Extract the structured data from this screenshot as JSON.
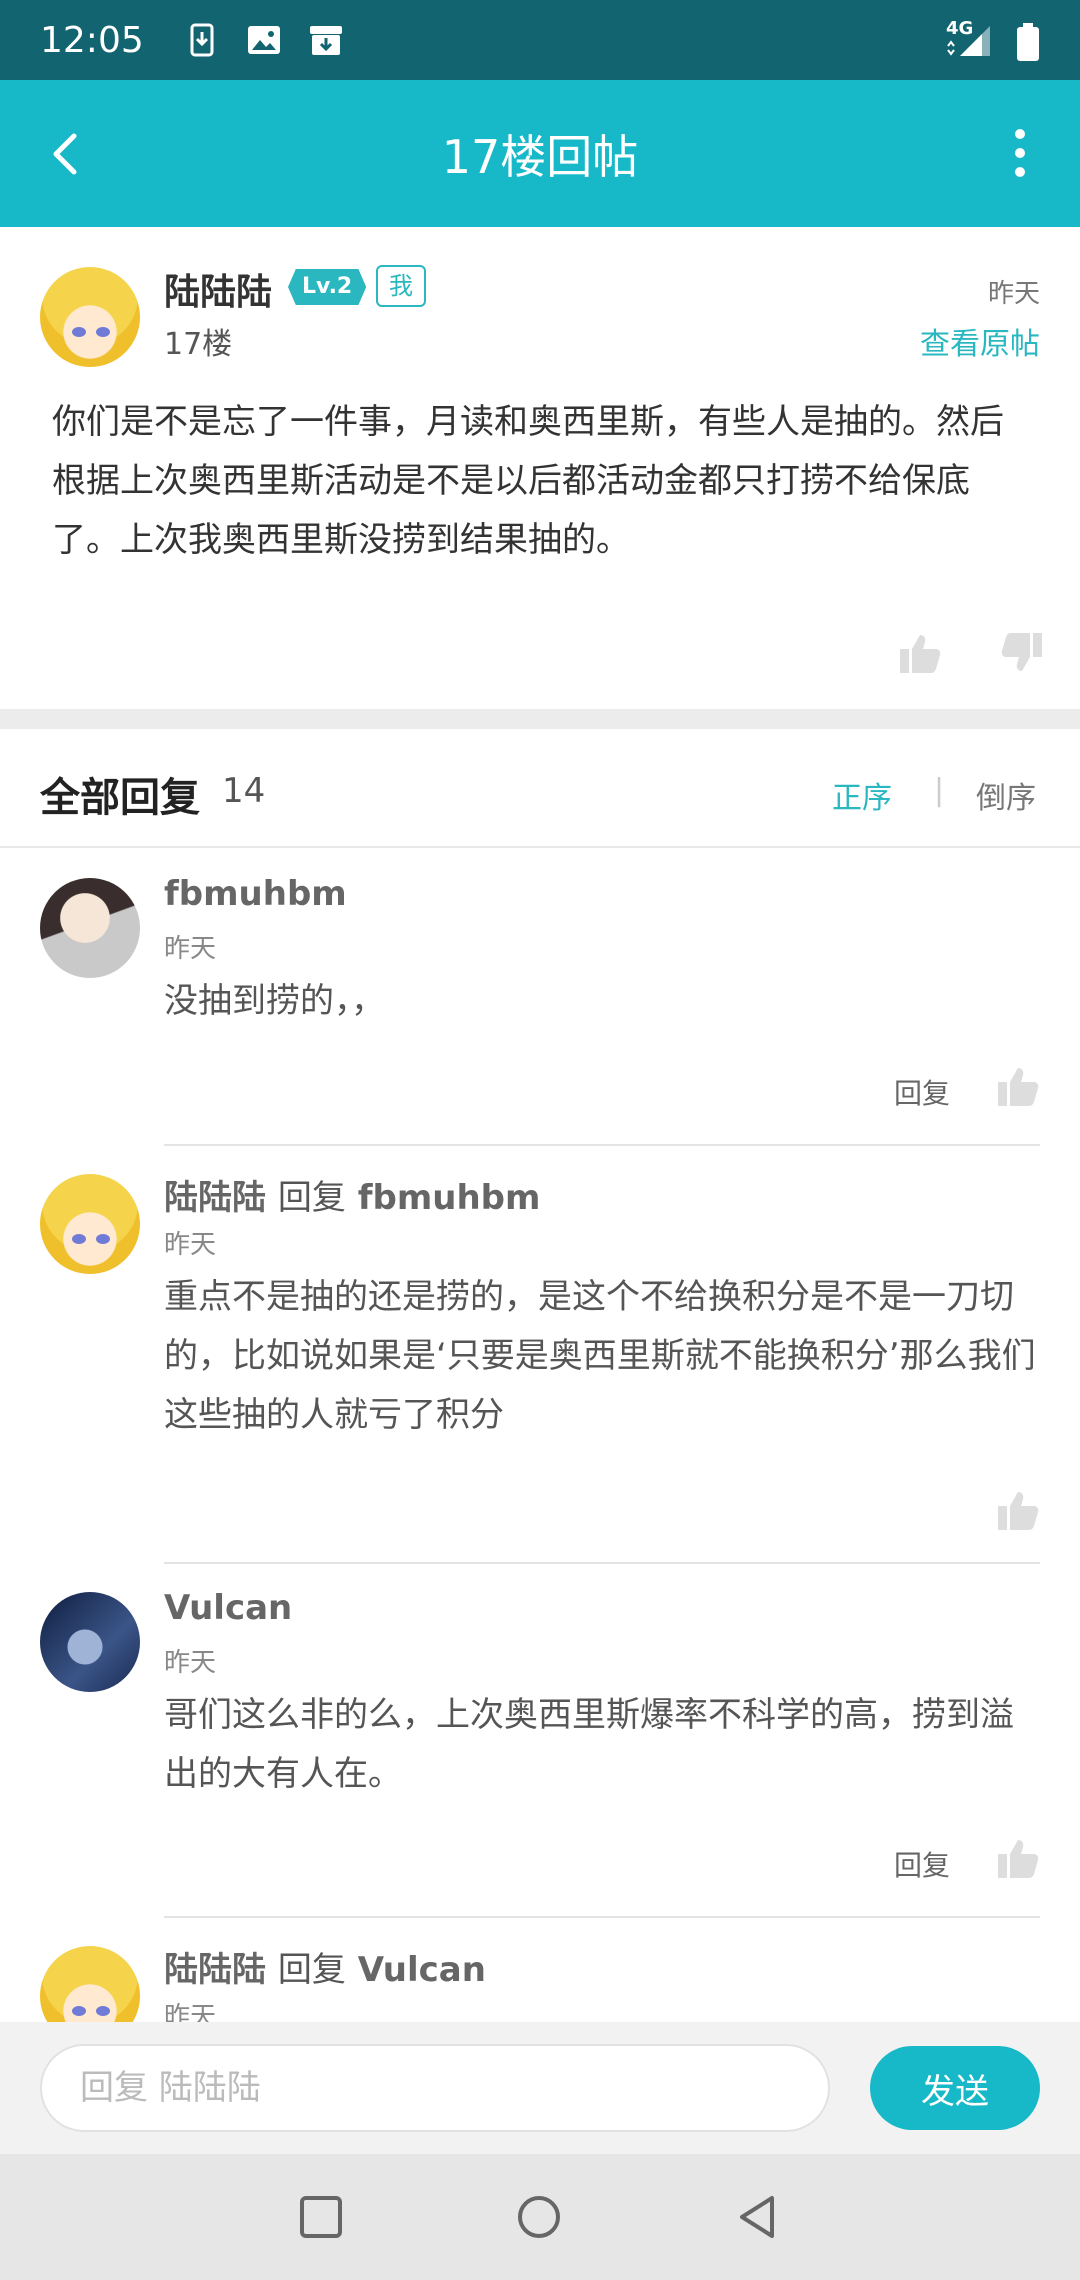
{
  "status_bar": {
    "time": "12:05",
    "network": "4G"
  },
  "header": {
    "title": "17楼回帖"
  },
  "post": {
    "author": "陆陆陆",
    "level": "Lv.2",
    "me_badge": "我",
    "floor": "17楼",
    "date": "昨天",
    "view_original": "查看原帖",
    "content": "你们是不是忘了一件事，月读和奥西里斯，有些人是抽的。然后根据上次奥西里斯活动是不是以后都活动金都只打捞不给保底了。上次我奥西里斯没捞到结果抽的。"
  },
  "replies_header": {
    "title": "全部回复",
    "count": "14",
    "sort_asc": "正序",
    "sort_sep": "|",
    "sort_desc": "倒序"
  },
  "replies": [
    {
      "author": "fbmuhbm",
      "reply_to_word": "",
      "reply_to": "",
      "time": "昨天",
      "text": "没抽到捞的，，",
      "reply_label": "回复"
    },
    {
      "author": "陆陆陆",
      "reply_to_word": "回复",
      "reply_to": "fbmuhbm",
      "time": "昨天",
      "text": "重点不是抽的还是捞的，是这个不给换积分是不是一刀切的，比如说如果是‘只要是奥西里斯就不能换积分’那么我们这些抽的人就亏了积分",
      "reply_label": ""
    },
    {
      "author": "Vulcan",
      "reply_to_word": "",
      "reply_to": "",
      "time": "昨天",
      "text": "哥们这么非的么，上次奥西里斯爆率不科学的高，捞到溢出的大有人在。",
      "reply_label": "回复"
    },
    {
      "author": "陆陆陆",
      "reply_to_word": "回复",
      "reply_to": "Vulcan",
      "time": "昨天",
      "text": "",
      "reply_label": ""
    }
  ],
  "input_bar": {
    "placeholder": "回复 陆陆陆",
    "send_label": "发送"
  },
  "colors": {
    "accent": "#17b8c8",
    "status_bar": "#126570",
    "teal_text": "#2ab7c0"
  }
}
